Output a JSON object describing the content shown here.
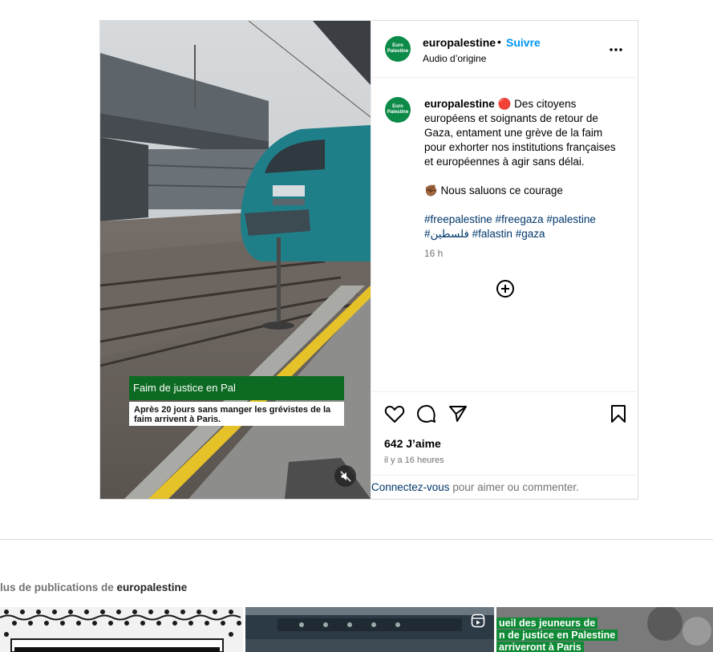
{
  "post": {
    "username": "europalestine",
    "follow_label": "Suivre",
    "separator": "•",
    "audio": "Audio d’origine",
    "avatar_text": "Euro\nPalestine",
    "caption": {
      "username": "europalestine",
      "text1": " 🔴 Des citoyens européens et soignants de retour de Gaza, entament une grève de la faim pour exhorter nos institutions françaises et européennes à agir sans délai.",
      "text2": "✊🏾 Nous saluons ce courage",
      "hashtags": "#freepalestine #freegaza #palestine #فلسطين #falastin #gaza"
    },
    "time_short": "16 h",
    "likes": "642 J’aime",
    "time_full": "il y a 16 heures",
    "login_link": "Connectez-vous",
    "login_rest": " pour aimer ou commenter."
  },
  "video": {
    "overlay_title": "Faim de justice en Pal",
    "overlay_subtitle": "Après 20 jours sans manger les grévistes de la faim arrivent à Paris."
  },
  "more": {
    "prefix": "lus de publications de ",
    "username": "europalestine"
  },
  "thumbnails": {
    "third_text_1": "ueil des jeuneurs de",
    "third_text_2": "n de justice en Palestine",
    "third_text_3": "arriveront à Paris"
  },
  "colors": {
    "accent": "#0095f6",
    "link": "#00376b",
    "avatar": "#0c8a47",
    "overlay_green": "#0d6a22"
  },
  "icons": [
    "more-icon",
    "plus-circle-icon",
    "heart-icon",
    "comment-icon",
    "share-icon",
    "bookmark-icon",
    "mute-icon",
    "reel-icon"
  ]
}
